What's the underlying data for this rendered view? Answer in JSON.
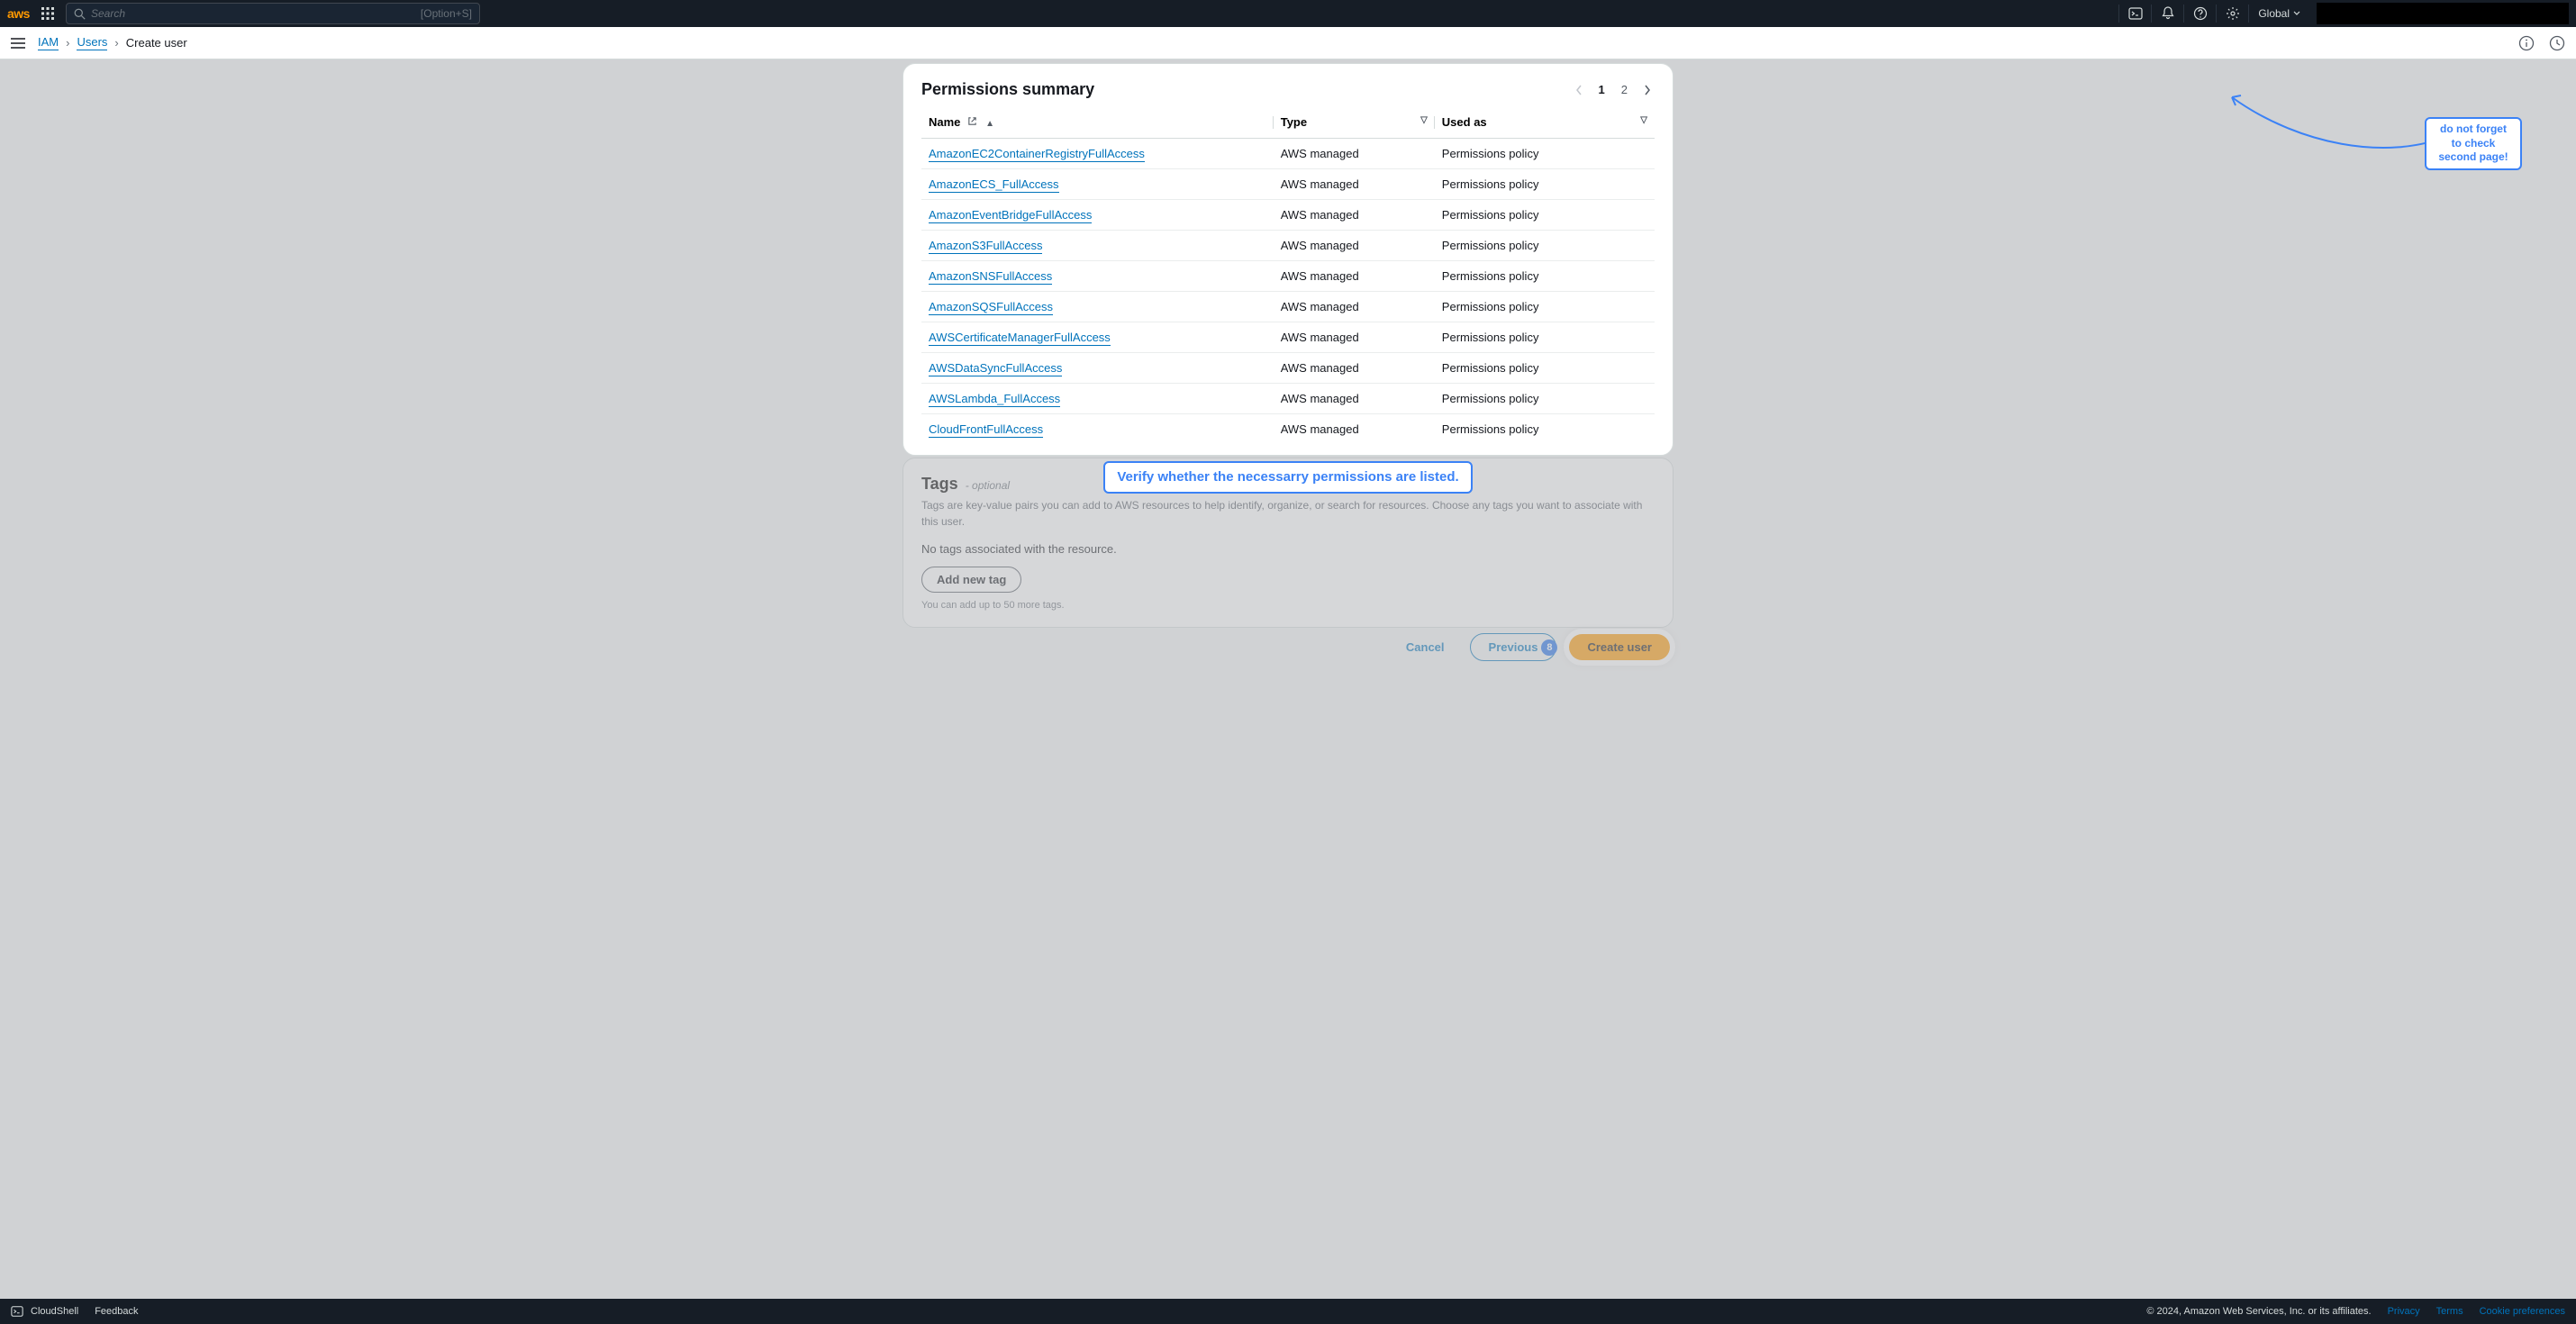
{
  "topnav": {
    "logo_text": "aws",
    "search_placeholder": "Search",
    "search_shortcut": "[Option+S]",
    "region": "Global"
  },
  "breadcrumbs": {
    "items": [
      "IAM",
      "Users",
      "Create user"
    ]
  },
  "panel": {
    "title": "Permissions summary",
    "columns": {
      "name": "Name",
      "type": "Type",
      "used": "Used as"
    },
    "pager": {
      "current": "1",
      "other": "2"
    },
    "rows": [
      {
        "name": "AmazonEC2ContainerRegistryFullAccess",
        "type": "AWS managed",
        "used": "Permissions policy"
      },
      {
        "name": "AmazonECS_FullAccess",
        "type": "AWS managed",
        "used": "Permissions policy"
      },
      {
        "name": "AmazonEventBridgeFullAccess",
        "type": "AWS managed",
        "used": "Permissions policy"
      },
      {
        "name": "AmazonS3FullAccess",
        "type": "AWS managed",
        "used": "Permissions policy"
      },
      {
        "name": "AmazonSNSFullAccess",
        "type": "AWS managed",
        "used": "Permissions policy"
      },
      {
        "name": "AmazonSQSFullAccess",
        "type": "AWS managed",
        "used": "Permissions policy"
      },
      {
        "name": "AWSCertificateManagerFullAccess",
        "type": "AWS managed",
        "used": "Permissions policy"
      },
      {
        "name": "AWSDataSyncFullAccess",
        "type": "AWS managed",
        "used": "Permissions policy"
      },
      {
        "name": "AWSLambda_FullAccess",
        "type": "AWS managed",
        "used": "Permissions policy"
      },
      {
        "name": "CloudFrontFullAccess",
        "type": "AWS managed",
        "used": "Permissions policy"
      }
    ]
  },
  "tags": {
    "title": "Tags",
    "optional": "- optional",
    "description": "Tags are key-value pairs you can add to AWS resources to help identify, organize, or search for resources. Choose any tags you want to associate with this user.",
    "empty_note": "No tags associated with the resource.",
    "add_btn": "Add new tag",
    "hint": "You can add up to 50 more tags."
  },
  "actions": {
    "cancel": "Cancel",
    "previous": "Previous",
    "step_badge": "8",
    "create": "Create user"
  },
  "annotations": {
    "verify": "Verify whether the necessarry permissions are listed.",
    "page2": "do not forget to check second page!"
  },
  "footer": {
    "cloudshell": "CloudShell",
    "feedback": "Feedback",
    "copyright": "© 2024, Amazon Web Services, Inc. or its affiliates.",
    "privacy": "Privacy",
    "terms": "Terms",
    "cookie": "Cookie preferences"
  }
}
